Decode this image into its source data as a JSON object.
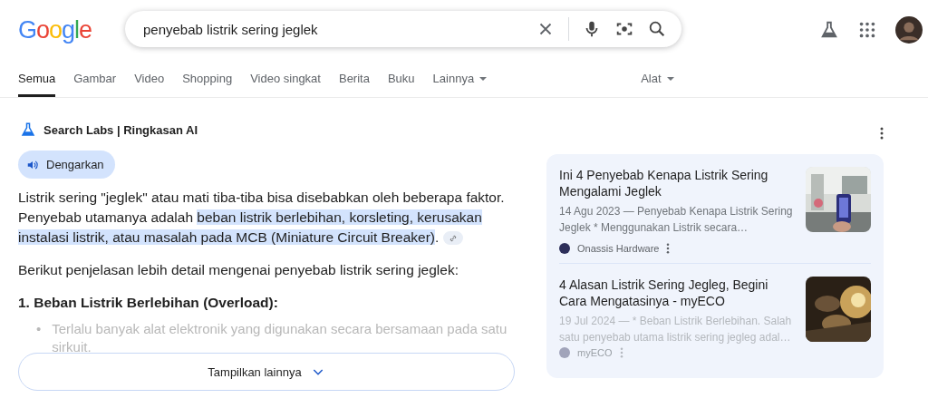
{
  "logo": "Google",
  "search": {
    "value": "penyebab listrik sering jeglek"
  },
  "tabs": [
    {
      "label": "Semua",
      "selected": true,
      "dropdown": false
    },
    {
      "label": "Gambar",
      "selected": false,
      "dropdown": false
    },
    {
      "label": "Video",
      "selected": false,
      "dropdown": false
    },
    {
      "label": "Shopping",
      "selected": false,
      "dropdown": false
    },
    {
      "label": "Video singkat",
      "selected": false,
      "dropdown": false
    },
    {
      "label": "Berita",
      "selected": false,
      "dropdown": false
    },
    {
      "label": "Buku",
      "selected": false,
      "dropdown": false
    },
    {
      "label": "Lainnya",
      "selected": false,
      "dropdown": true
    }
  ],
  "tools": {
    "label": "Alat"
  },
  "ai_overview": {
    "title": "Search Labs | Ringkasan AI",
    "listen_button": "Dengarkan",
    "paragraph": [
      {
        "text": "Listrik sering \"jeglek\" atau mati tiba-tiba bisa disebabkan oleh beberapa faktor. Penyebab utamanya adalah ",
        "highlighted": false
      },
      {
        "text": "beban listrik berlebihan, korsleting, kerusakan instalasi listrik, atau masalah pada MCB (Miniature Circuit Breaker)",
        "highlighted": true
      },
      {
        "text": ".",
        "highlighted": false
      }
    ],
    "intro": "Berikut penjelasan lebih detail mengenai penyebab listrik sering jeglek:",
    "heading": "1. Beban Listrik Berlebihan (Overload):",
    "bullets": [
      {
        "marker": "•",
        "text": "Terlalu banyak alat elektronik yang digunakan secara bersamaan pada satu sirkuit.",
        "faded": true
      }
    ],
    "show_more": "Tampilkan lainnya",
    "sources": [
      {
        "title": "Ini 4 Penyebab Kenapa Listrik Sering Mengalami Jeglek",
        "snippet": "14 Agu 2023 — Penyebab Kenapa Listrik Sering Jeglek * Menggunakan Listrik secara…",
        "site": "Onassis Hardware",
        "faded": false,
        "kind": "picture"
      },
      {
        "title": "4 Alasan Listrik Sering Jegleg, Begini Cara Mengatasinya - myECO",
        "snippet": "19 Jul 2024 — * Beban Listrik Berlebihan. Salah satu penyebab utama listrik sering jegleg adal…",
        "site": "myECO",
        "faded": true,
        "kind": "picture"
      }
    ]
  }
}
